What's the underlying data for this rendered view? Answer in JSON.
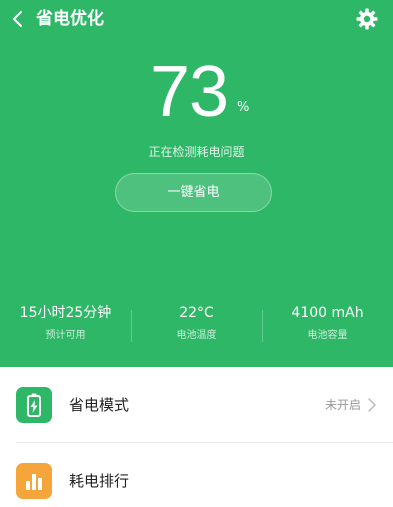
{
  "header": {
    "title": "省电优化"
  },
  "battery": {
    "percent": "73",
    "percent_sign": "%",
    "status_text": "正在检测耗电问题",
    "action_label": "一键省电"
  },
  "stats": [
    {
      "value": "15小时25分钟",
      "label": "预计可用"
    },
    {
      "value": "22°C",
      "label": "电池温度"
    },
    {
      "value": "4100 mAh",
      "label": "电池容量"
    }
  ],
  "list": [
    {
      "label": "省电模式",
      "value": "未开启",
      "icon": "battery-icon",
      "icon_color": "#2fb768"
    },
    {
      "label": "耗电排行",
      "value": "",
      "icon": "bar-chart-icon",
      "icon_color": "#f5a53a"
    }
  ],
  "colors": {
    "accent": "#2fb768",
    "orange": "#f5a53a"
  }
}
